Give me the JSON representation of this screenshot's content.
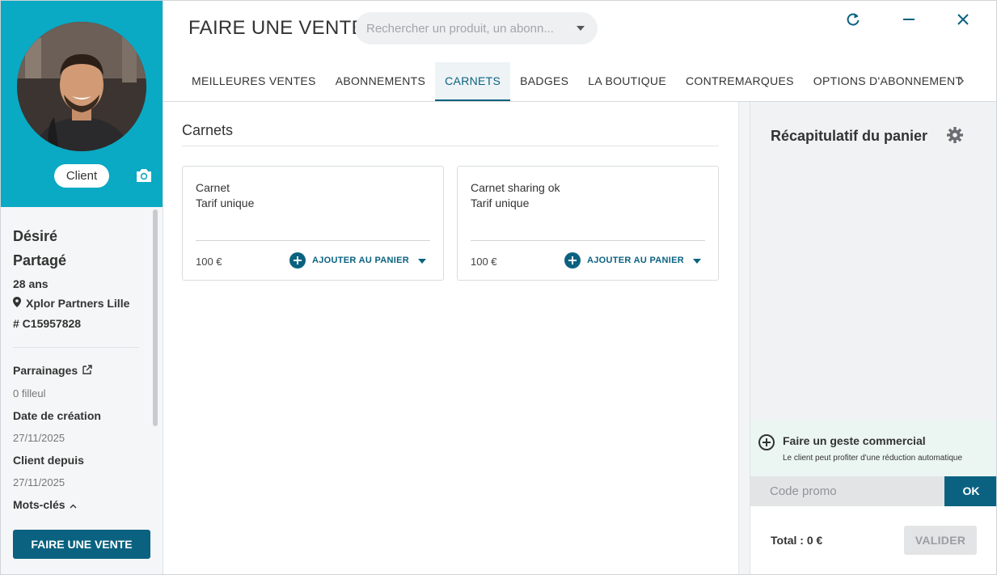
{
  "sidebar": {
    "client_badge": "Client",
    "first_name": "Désiré",
    "last_name": "Partagé",
    "age": "28 ans",
    "location": "Xplor Partners Lille",
    "client_id": "# C15957828",
    "referrals_label": "Parrainages",
    "referrals_value": "0 filleul",
    "creation_label": "Date de création",
    "creation_value": "27/11/2025",
    "client_since_label": "Client depuis",
    "client_since_value": "27/11/2025",
    "keywords_label": "Mots-clés",
    "sell_button": "FAIRE UNE VENTE",
    "clipped_text": "...."
  },
  "header": {
    "title": "FAIRE UNE VENTE",
    "search_placeholder": "Rechercher un produit, un abonn..."
  },
  "tabs": [
    {
      "label": "MEILLEURES VENTES",
      "active": false
    },
    {
      "label": "ABONNEMENTS",
      "active": false
    },
    {
      "label": "CARNETS",
      "active": true
    },
    {
      "label": "BADGES",
      "active": false
    },
    {
      "label": "LA BOUTIQUE",
      "active": false
    },
    {
      "label": "CONTREMARQUES",
      "active": false
    },
    {
      "label": "OPTIONS D'ABONNEMENT",
      "active": false
    }
  ],
  "content": {
    "section_title": "Carnets",
    "cards": [
      {
        "title": "Carnet",
        "subtitle": "Tarif unique",
        "price": "100 €",
        "add_label": "AJOUTER AU PANIER"
      },
      {
        "title": "Carnet sharing ok",
        "subtitle": "Tarif unique",
        "price": "100 €",
        "add_label": "AJOUTER AU PANIER"
      }
    ]
  },
  "cart": {
    "title": "Récapitulatif du panier",
    "gesture_title": "Faire un geste commercial",
    "gesture_subtitle": "Le client peut profiter d'une réduction automatique",
    "promo_placeholder": "Code promo",
    "ok_label": "OK",
    "total": "Total : 0 €",
    "validate_label": "VALIDER"
  },
  "colors": {
    "accent": "#0a6280",
    "profile_header": "#0aa9c4",
    "gesture_bg": "#ebf6f3"
  },
  "icons": [
    "camera-icon",
    "location-pin-icon",
    "external-link-icon",
    "chevron-up-icon",
    "refresh-icon",
    "minimize-icon",
    "close-icon",
    "chevron-right-icon",
    "gear-icon",
    "plus-circle-icon",
    "dropdown-caret-icon"
  ]
}
